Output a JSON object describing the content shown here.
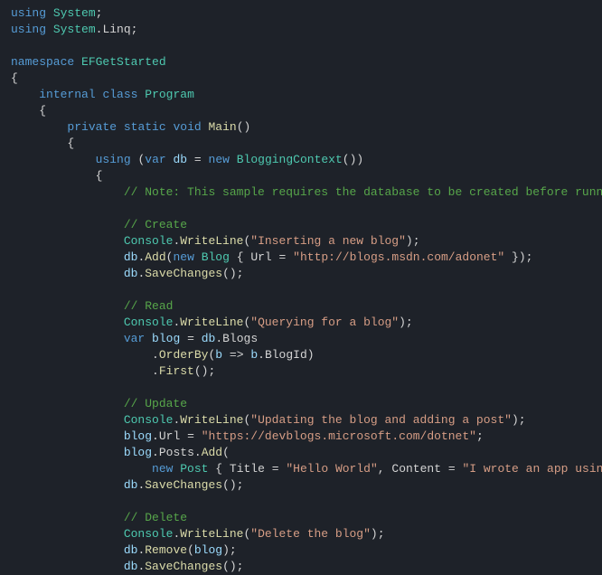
{
  "t": {
    "using": "using",
    "System": "System",
    "Linq": "Linq",
    "namespace": "namespace",
    "EFGetStarted": "EFGetStarted",
    "internal": "internal",
    "class": "class",
    "Program": "Program",
    "private": "private",
    "static": "static",
    "void": "void",
    "Main": "Main",
    "var": "var",
    "db": "db",
    "new": "new",
    "BloggingContext": "BloggingContext",
    "commentNote": "// Note: This sample requires the database to be created before runni",
    "commentCreate": "// Create",
    "Console": "Console",
    "WriteLine": "WriteLine",
    "strInsert": "\"Inserting a new blog\"",
    "Add": "Add",
    "Blog": "Blog",
    "Url": "Url",
    "strBlogUrl": "\"http://blogs.msdn.com/adonet\"",
    "SaveChanges": "SaveChanges",
    "commentRead": "// Read",
    "strQuery": "\"Querying for a blog\"",
    "blog": "blog",
    "Blogs": "Blogs",
    "OrderBy": "OrderBy",
    "b": "b",
    "BlogId": "BlogId",
    "First": "First",
    "commentUpdate": "// Update",
    "strUpdate": "\"Updating the blog and adding a post\"",
    "strDevBlog": "\"https://devblogs.microsoft.com/dotnet\"",
    "Posts": "Posts",
    "Post": "Post",
    "Title": "Title",
    "strHello": "\"Hello World\"",
    "Content": "Content",
    "strWrote": "\"I wrote an app using",
    "commentDelete": "// Delete",
    "strDelete": "\"Delete the blog\"",
    "Remove": "Remove"
  }
}
